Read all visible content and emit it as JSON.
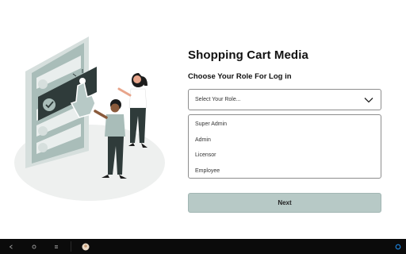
{
  "app": {
    "title": "Shopping Cart Media",
    "subtitle": "Choose Your Role For Log in"
  },
  "role_select": {
    "placeholder": "Select Your Role...",
    "icon": "chevron-down-icon",
    "options": [
      "Super Admin",
      "Admin",
      "Licensor",
      "Employee"
    ]
  },
  "actions": {
    "next_label": "Next"
  },
  "illustration": {
    "icons": [
      "phone-screen-illustration",
      "hand-pointer-icon",
      "checkmark-icon",
      "woman-figure",
      "man-figure"
    ]
  },
  "taskbar": {
    "icons": [
      "back-nav-icon",
      "home-nav-icon",
      "recents-nav-icon",
      "app-avatar-icon",
      "assistant-icon"
    ]
  },
  "colors": {
    "accent": "#b7c9c6",
    "illustration_main": "#a9bdb9",
    "illustration_dark": "#2f3b3a",
    "taskbar": "#0b0b0b",
    "assistant": "#1e88e5"
  }
}
